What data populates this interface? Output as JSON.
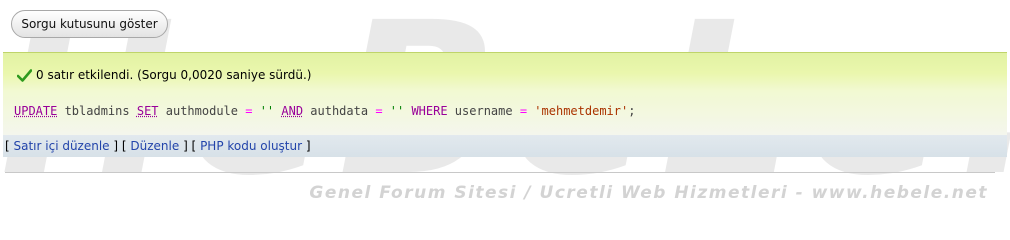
{
  "watermark": {
    "brand": "HeBeLe.net",
    "tagline": "Genel Forum Sitesi / Ucretli Web Hizmetleri - www.hebele.net"
  },
  "toggle_button": {
    "label": "Sorgu kutusunu göster"
  },
  "result": {
    "message": "0 satır etkilendi. (Sorgu 0,0020 saniye sürdü.)",
    "icon": "checkmark-icon",
    "sql": {
      "update": "UPDATE",
      "table": " tbladmins ",
      "set": "SET",
      "col1": " authmodule ",
      "eq1": "=",
      "val1": " '' ",
      "and": "AND",
      "col2": " authdata ",
      "eq2": "=",
      "val2": " '' ",
      "where": "WHERE",
      "col3": " username ",
      "eq3": "=",
      "sp": " ",
      "val3": "'mehmetdemir'",
      "end": ";"
    }
  },
  "links": {
    "inline_edit": "Satır içi düzenle",
    "edit": "Düzenle",
    "php_code": "PHP kodu oluştur"
  },
  "colors": {
    "success_bg": "#e6f4a6",
    "link": "#2244aa",
    "keyword": "#990099",
    "operator": "#ff00ff"
  }
}
